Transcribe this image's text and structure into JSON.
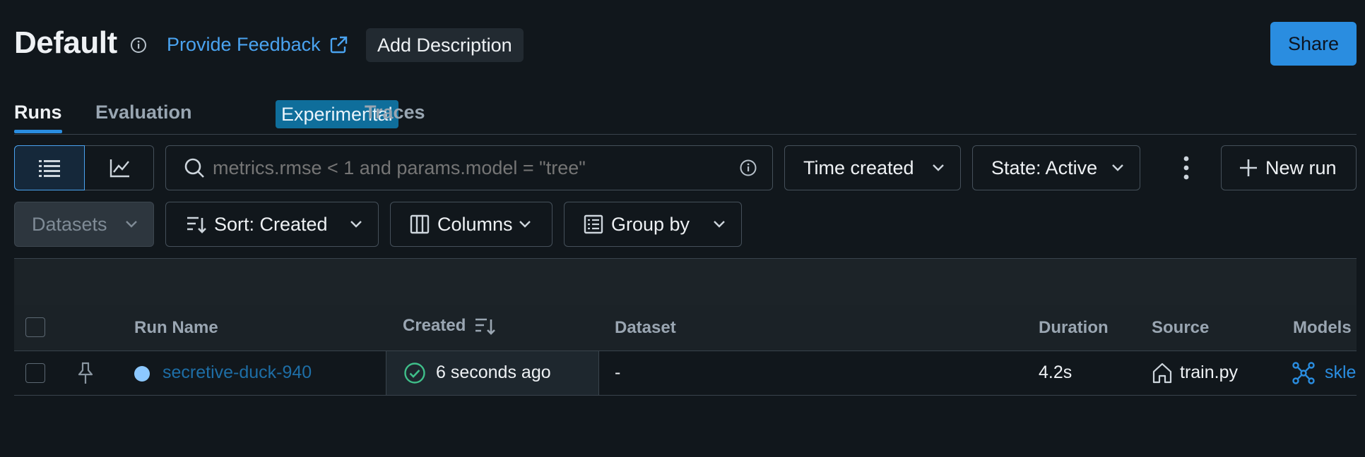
{
  "header": {
    "title": "Default",
    "feedback_label": "Provide Feedback",
    "add_description_label": "Add Description",
    "share_label": "Share"
  },
  "tabs": [
    {
      "label": "Runs",
      "active": true
    },
    {
      "label": "Evaluation",
      "badge": "Experimental"
    },
    {
      "label": "Traces"
    }
  ],
  "toolbar": {
    "search_placeholder": "metrics.rmse < 1 and params.model = \"tree\"",
    "time_filter": "Time created",
    "state_filter": "State: Active",
    "new_run_label": "New run",
    "datasets_label": "Datasets",
    "sort_label": "Sort: Created",
    "columns_label": "Columns",
    "group_by_label": "Group by"
  },
  "table": {
    "columns": [
      "Run Name",
      "Created",
      "Dataset",
      "Duration",
      "Source",
      "Models"
    ],
    "rows": [
      {
        "run_name": "secretive-duck-940",
        "run_color": "#8cc8ff",
        "created": "6 seconds ago",
        "dataset": "-",
        "duration": "4.2s",
        "source": "train.py",
        "models": "skle"
      }
    ]
  },
  "colors": {
    "accent": "#2a8de0",
    "background": "#11171c",
    "success": "#3fbf8a"
  }
}
